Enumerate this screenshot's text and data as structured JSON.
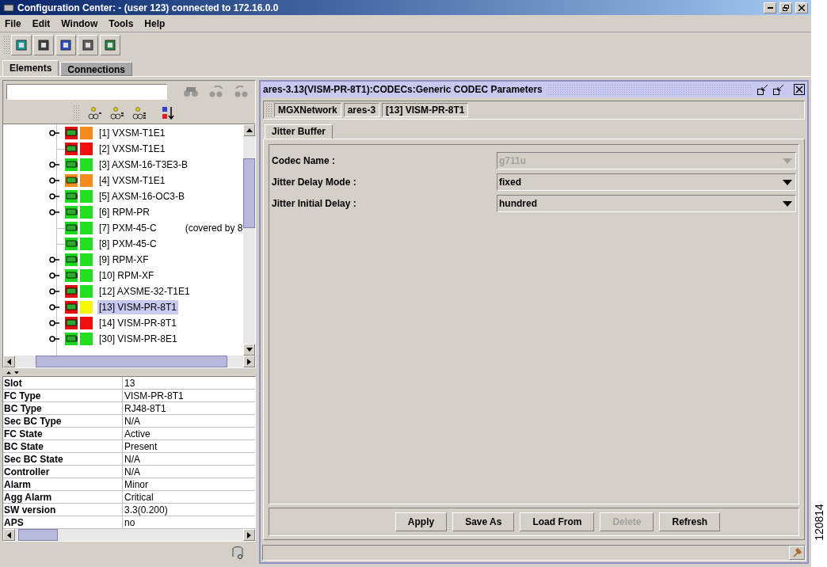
{
  "window": {
    "title": "Configuration Center: - (user 123) connected to 172.16.0.0"
  },
  "menu": [
    "File",
    "Edit",
    "Window",
    "Tools",
    "Help"
  ],
  "main_tabs": [
    {
      "label": "Elements",
      "selected": true
    },
    {
      "label": "Connections",
      "selected": false
    }
  ],
  "tree": {
    "items": [
      {
        "label": "[1] VXSM-T1E1",
        "expandable": true,
        "card": {
          "color": "#e01010"
        },
        "color": "#f58a1f",
        "selected": false
      },
      {
        "label": "[2] VXSM-T1E1",
        "expandable": false,
        "card": {
          "color": "#e01010"
        },
        "color": "#f01010",
        "selected": false
      },
      {
        "label": "[3] AXSM-16-T3E3-B",
        "expandable": true,
        "card": {
          "color": "#1ed81e"
        },
        "color": "#20e020",
        "selected": false
      },
      {
        "label": "[4] VXSM-T1E1",
        "expandable": true,
        "card": {
          "color": "#f58a1f"
        },
        "color": "#f58a1f",
        "selected": false
      },
      {
        "label": "[5] AXSM-16-OC3-B",
        "expandable": true,
        "card": {
          "color": "#1ed81e"
        },
        "color": "#20e020",
        "selected": false
      },
      {
        "label": "[6] RPM-PR",
        "expandable": true,
        "card": {
          "color": "#1ed81e"
        },
        "color": "#20e020",
        "selected": false
      },
      {
        "label": "[7] PXM-45-C",
        "note": "(covered by 8",
        "expandable": false,
        "card": {
          "color": "#1ed81e"
        },
        "color": "#20e020",
        "selected": false
      },
      {
        "label": "[8] PXM-45-C",
        "expandable": false,
        "card": {
          "color": "#1ed81e"
        },
        "color": "#20e020",
        "selected": false
      },
      {
        "label": "[9] RPM-XF",
        "expandable": true,
        "card": {
          "color": "#1ed81e"
        },
        "color": "#20e020",
        "selected": false
      },
      {
        "label": "[10] RPM-XF",
        "expandable": true,
        "card": {
          "color": "#1ed81e"
        },
        "color": "#20e020",
        "selected": false
      },
      {
        "label": "[12] AXSME-32-T1E1",
        "expandable": true,
        "card": {
          "color": "#e01010"
        },
        "color": "#20e020",
        "selected": false
      },
      {
        "label": "[13] VISM-PR-8T1",
        "expandable": true,
        "card": {
          "color": "#e01010"
        },
        "color": "#f8f800",
        "selected": true
      },
      {
        "label": "[14] VISM-PR-8T1",
        "expandable": true,
        "card": {
          "color": "#e01010"
        },
        "color": "#f01010",
        "selected": false
      },
      {
        "label": "[30] VISM-PR-8E1",
        "expandable": true,
        "card": {
          "color": "#1ed81e"
        },
        "color": "#20e020",
        "selected": false
      }
    ]
  },
  "properties": [
    [
      "Slot",
      "13"
    ],
    [
      "FC Type",
      "VISM-PR-8T1"
    ],
    [
      "BC Type",
      "RJ48-8T1"
    ],
    [
      "Sec BC Type",
      "N/A"
    ],
    [
      "FC State",
      "Active"
    ],
    [
      "BC State",
      "Present"
    ],
    [
      "Sec BC State",
      "N/A"
    ],
    [
      "Controller",
      "N/A"
    ],
    [
      "Alarm",
      "Minor"
    ],
    [
      "Agg Alarm",
      "Critical"
    ],
    [
      "SW version",
      "3.3(0.200)"
    ],
    [
      "APS",
      "no"
    ]
  ],
  "frame": {
    "title": "ares-3.13(VISM-PR-8T1):CODECs:Generic CODEC Parameters",
    "breadcrumb": [
      "MGXNetwork",
      "ares-3",
      "[13] VISM-PR-8T1"
    ],
    "tabs": [
      {
        "label": "Jitter Buffer",
        "selected": true
      }
    ],
    "fields": [
      {
        "label": "Codec Name :",
        "value": "g711u",
        "disabled": true
      },
      {
        "label": "Jitter Delay Mode :",
        "value": "fixed",
        "disabled": false
      },
      {
        "label": "Jitter Initial Delay :",
        "value": "hundred",
        "disabled": false
      }
    ],
    "buttons": [
      {
        "label": "Apply",
        "disabled": false
      },
      {
        "label": "Save As",
        "disabled": false
      },
      {
        "label": "Load From",
        "disabled": false
      },
      {
        "label": "Delete",
        "disabled": true
      },
      {
        "label": "Refresh",
        "disabled": false
      }
    ]
  },
  "figure_id": "120814"
}
